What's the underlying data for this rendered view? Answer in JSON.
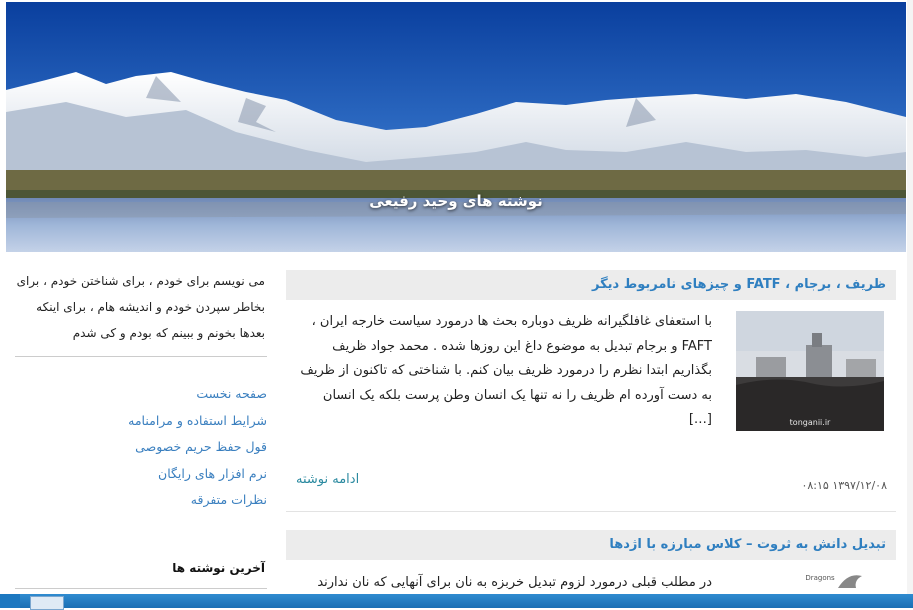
{
  "banner": {
    "site_title": "نوشته های وحید رفیعی"
  },
  "sidebar": {
    "about": "می نویسم برای خودم ، برای شناختن خودم ، برای بخاطر سپردن خودم و اندیشه هام ، برای اینکه بعدها بخونم و ببینم که بودم و کی شدم",
    "links": [
      "صفحه نخست",
      "شرایط استفاده و مرامنامه",
      "قول حفظ حریم خصوصی",
      "نرم افزار های رایگان",
      "نظرات متفرقه"
    ],
    "recent_title": "آخرین نوشته ها"
  },
  "posts": [
    {
      "title": "ظریف ، برجام ، FATF و چیزهای نامربوط دیگر",
      "excerpt": "با استعفای غافلگیرانه ظریف دوباره بحث ها درمورد سیاست خارجه ایران ، FAFT و برجام تبدیل به موضوع داغ این روزها شده . محمد جواد ظریف بگذاریم ابتدا نظرم را درمورد ظریف بیان کنم. با شناختی که تاکنون از ظریف به دست آورده ام  ظریف را نه تنها یک انسان وطن پرست بلکه یک انسان […]",
      "read_more": "ادامه نوشته",
      "date": "۱۳۹۷/۱۲/۰۸ ۰۸:۱۵",
      "thumb_watermark": "tonganii.ir"
    },
    {
      "title": "تبدیل دانش به ثروت – کلاس مبارزه با اژدها",
      "excerpt": "در مطلب قبلی درمورد لزوم تبدیل خربزه به نان برای آنهایی که نان ندارند",
      "thumb_label": "Dragons"
    }
  ],
  "colors": {
    "link": "#3a7fbf",
    "title": "#2f7fc0",
    "title_bar": "#ececec",
    "taskbar": "#1f75bd"
  }
}
